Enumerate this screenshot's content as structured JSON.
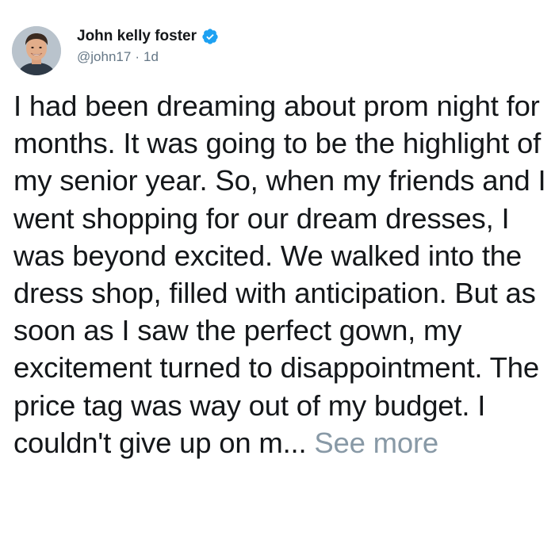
{
  "author": {
    "display_name": "John kelly foster",
    "handle": "@john17",
    "separator": "·",
    "time_ago": "1d",
    "verified": true
  },
  "tweet": {
    "text": "I had been dreaming about prom night for months. It was going to be the highlight of my senior year. So, when my friends and I went shopping for our dream dresses, I was beyond excited. We walked into the dress shop, filled with anticipation. But as soon as I saw the perfect gown, my excitement turned to disappointment. The price tag was way out of my budget. I couldn't give up on m...",
    "see_more_label": "See more"
  },
  "colors": {
    "text": "#14171a",
    "secondary": "#657786",
    "see_more": "#8899a6",
    "verified_badge": "#1da1f2"
  },
  "icons": {
    "verified": "verified-badge-icon",
    "avatar": "profile-photo"
  }
}
